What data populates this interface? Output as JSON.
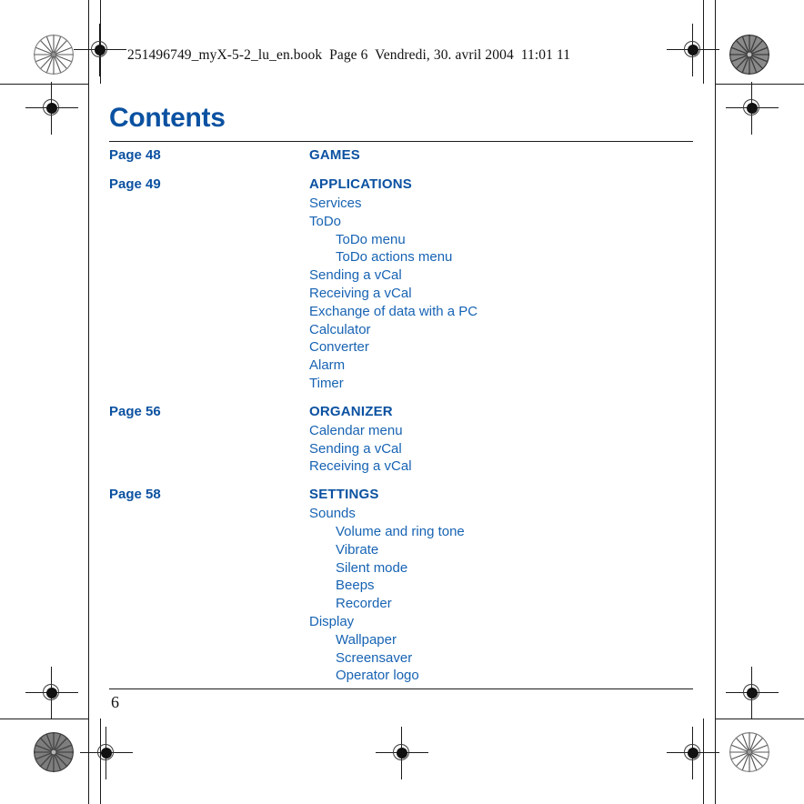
{
  "book_header": "251496749_myX-5-2_lu_en.book  Page 6  Vendredi, 30. avril 2004  11:01 11",
  "page_title": "Contents",
  "folio": "6",
  "colors": {
    "heading_blue": "#0b51a1",
    "entry_blue": "#1763b3",
    "rule_black": "#1d1d1d"
  },
  "sections": [
    {
      "page_ref": "Page 48",
      "title": "GAMES",
      "entries": []
    },
    {
      "page_ref": "Page 49",
      "title": "APPLICATIONS",
      "entries": [
        {
          "label": "Services",
          "level": 1
        },
        {
          "label": "ToDo",
          "level": 1
        },
        {
          "label": "ToDo menu",
          "level": 2
        },
        {
          "label": "ToDo actions menu",
          "level": 2
        },
        {
          "label": "Sending a vCal",
          "level": 1
        },
        {
          "label": "Receiving a vCal",
          "level": 1
        },
        {
          "label": "Exchange of data with a PC",
          "level": 1
        },
        {
          "label": "Calculator",
          "level": 1
        },
        {
          "label": "Converter",
          "level": 1
        },
        {
          "label": "Alarm",
          "level": 1
        },
        {
          "label": "Timer",
          "level": 1
        }
      ]
    },
    {
      "page_ref": "Page 56",
      "title": "ORGANIZER",
      "entries": [
        {
          "label": "Calendar menu",
          "level": 1
        },
        {
          "label": "Sending a vCal",
          "level": 1
        },
        {
          "label": "Receiving a vCal",
          "level": 1
        }
      ]
    },
    {
      "page_ref": "Page 58",
      "title": "SETTINGS",
      "entries": [
        {
          "label": "Sounds",
          "level": 1
        },
        {
          "label": "Volume and ring tone",
          "level": 2
        },
        {
          "label": "Vibrate",
          "level": 2
        },
        {
          "label": "Silent mode",
          "level": 2
        },
        {
          "label": "Beeps",
          "level": 2
        },
        {
          "label": "Recorder",
          "level": 2
        },
        {
          "label": "Display",
          "level": 1
        },
        {
          "label": "Wallpaper",
          "level": 2
        },
        {
          "label": "Screensaver",
          "level": 2
        },
        {
          "label": "Operator logo",
          "level": 2
        }
      ]
    }
  ]
}
